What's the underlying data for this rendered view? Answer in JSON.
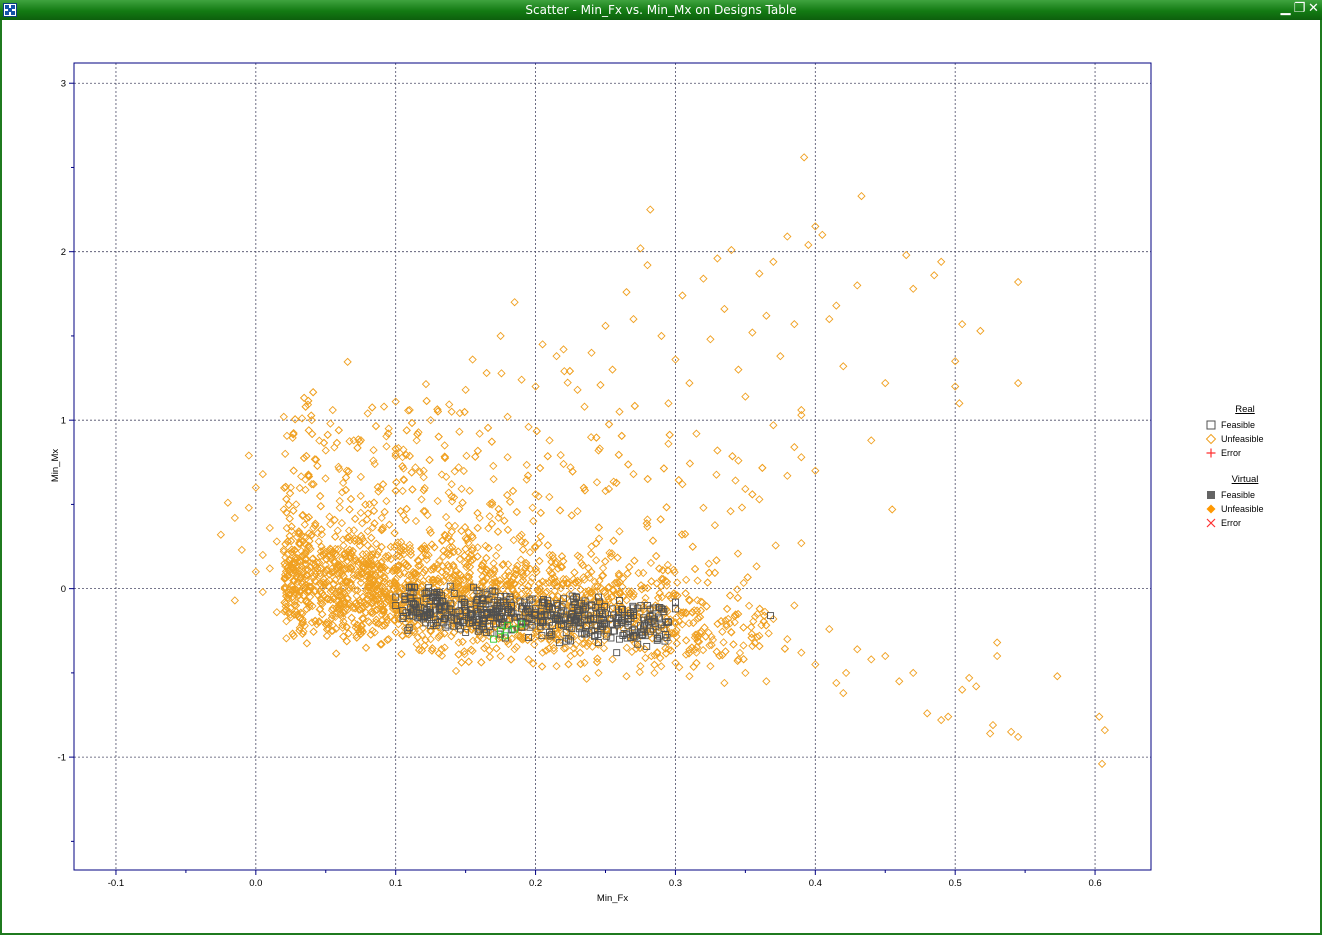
{
  "window": {
    "title": "Scatter - Min_Fx vs. Min_Mx on Designs Table",
    "minimize_glyph": "▁",
    "restore_glyph": "❐",
    "close_glyph": "✕"
  },
  "legend": {
    "groups": [
      {
        "title": "Real",
        "items": [
          {
            "label": "Feasible",
            "marker": "open-square",
            "color": "#505050"
          },
          {
            "label": "Unfeasible",
            "marker": "open-diamond",
            "color": "#f0a020"
          },
          {
            "label": "Error",
            "marker": "plus",
            "color": "#ff3030"
          }
        ]
      },
      {
        "title": "Virtual",
        "items": [
          {
            "label": "Feasible",
            "marker": "filled-square",
            "color": "#646464"
          },
          {
            "label": "Unfeasible",
            "marker": "filled-diamond",
            "color": "#ff9800"
          },
          {
            "label": "Error",
            "marker": "cross",
            "color": "#ff3030"
          }
        ]
      }
    ]
  },
  "chart_data": {
    "type": "scatter",
    "title": "",
    "xlabel": "Min_Fx",
    "ylabel": "Min_Mx",
    "xlim": [
      -0.13,
      0.64
    ],
    "ylim": [
      -1.67,
      3.12
    ],
    "xticks": [
      -0.1,
      0.0,
      0.1,
      0.2,
      0.3,
      0.4,
      0.5,
      0.6
    ],
    "xtick_labels": [
      "-0.1",
      "0.0",
      "0.1",
      "0.2",
      "0.3",
      "0.4",
      "0.5",
      "0.6"
    ],
    "yticks": [
      -1,
      0,
      1,
      2,
      3
    ],
    "ytick_labels": [
      "-1",
      "0",
      "1",
      "2",
      "3"
    ],
    "grid": true,
    "legend_position": "right",
    "colors": {
      "unfeasible": "#f0a020",
      "feasible": "#505050",
      "selected": "#2ecc2e",
      "axis": "#000080"
    },
    "series": [
      {
        "name": "Unfeasible",
        "marker": "open-diamond",
        "points": [
          [
            -0.02,
            0.51
          ],
          [
            -0.025,
            0.32
          ],
          [
            -0.015,
            0.42
          ],
          [
            -0.01,
            0.23
          ],
          [
            -0.015,
            -0.07
          ],
          [
            -0.005,
            0.79
          ],
          [
            -0.005,
            0.48
          ],
          [
            0.0,
            0.1
          ],
          [
            0.0,
            0.6
          ],
          [
            0.005,
            0.68
          ],
          [
            0.005,
            0.2
          ],
          [
            0.01,
            0.36
          ],
          [
            0.015,
            0.28
          ],
          [
            0.02,
            1.02
          ],
          [
            0.02,
            0.47
          ],
          [
            0.025,
            0.6
          ],
          [
            0.03,
            0.18
          ],
          [
            0.035,
            0.38
          ],
          [
            0.04,
            1.0
          ],
          [
            0.04,
            0.62
          ],
          [
            0.045,
            0.28
          ],
          [
            0.05,
            0.82
          ],
          [
            0.055,
            1.06
          ],
          [
            0.06,
            0.48
          ],
          [
            0.065,
            0.7
          ],
          [
            0.07,
            0.88
          ],
          [
            0.075,
            0.55
          ],
          [
            0.08,
            1.04
          ],
          [
            0.085,
            0.74
          ],
          [
            0.09,
            0.42
          ],
          [
            0.095,
            0.95
          ],
          [
            0.1,
            1.11
          ],
          [
            0.1,
            0.8
          ],
          [
            0.105,
            0.58
          ],
          [
            0.11,
            1.06
          ],
          [
            0.115,
            0.88
          ],
          [
            0.12,
            0.7
          ],
          [
            0.125,
            1.0
          ],
          [
            0.13,
            0.52
          ],
          [
            0.135,
            0.85
          ],
          [
            0.14,
            1.05
          ],
          [
            0.145,
            0.72
          ],
          [
            0.15,
            1.18
          ],
          [
            0.155,
            1.36
          ],
          [
            0.16,
            0.92
          ],
          [
            0.165,
            1.28
          ],
          [
            0.17,
            0.65
          ],
          [
            0.175,
            1.5
          ],
          [
            0.18,
            1.02
          ],
          [
            0.185,
            1.7
          ],
          [
            0.19,
            1.24
          ],
          [
            0.195,
            0.96
          ],
          [
            0.2,
            1.2
          ],
          [
            0.205,
            1.45
          ],
          [
            0.21,
            0.88
          ],
          [
            0.215,
            1.38
          ],
          [
            0.22,
            1.42
          ],
          [
            0.225,
            0.72
          ],
          [
            0.23,
            1.18
          ],
          [
            0.235,
            1.08
          ],
          [
            0.24,
            1.4
          ],
          [
            0.245,
            0.82
          ],
          [
            0.25,
            1.56
          ],
          [
            0.255,
            1.3
          ],
          [
            0.26,
            1.05
          ],
          [
            0.265,
            1.76
          ],
          [
            0.27,
            1.6
          ],
          [
            0.275,
            2.02
          ],
          [
            0.28,
            1.92
          ],
          [
            0.282,
            2.25
          ],
          [
            0.29,
            1.5
          ],
          [
            0.295,
            1.1
          ],
          [
            0.3,
            1.36
          ],
          [
            0.305,
            1.74
          ],
          [
            0.31,
            1.22
          ],
          [
            0.315,
            0.92
          ],
          [
            0.32,
            1.84
          ],
          [
            0.325,
            1.48
          ],
          [
            0.33,
            1.96
          ],
          [
            0.335,
            1.66
          ],
          [
            0.34,
            2.01
          ],
          [
            0.345,
            1.3
          ],
          [
            0.35,
            1.14
          ],
          [
            0.355,
            1.52
          ],
          [
            0.36,
            1.87
          ],
          [
            0.365,
            1.62
          ],
          [
            0.37,
            1.94
          ],
          [
            0.375,
            1.38
          ],
          [
            0.38,
            2.09
          ],
          [
            0.385,
            1.57
          ],
          [
            0.39,
            1.06
          ],
          [
            0.392,
            2.56
          ],
          [
            0.395,
            2.04
          ],
          [
            0.4,
            2.15
          ],
          [
            0.405,
            2.1
          ],
          [
            0.41,
            1.6
          ],
          [
            0.415,
            1.68
          ],
          [
            0.42,
            1.32
          ],
          [
            0.43,
            1.8
          ],
          [
            0.433,
            2.33
          ],
          [
            0.44,
            0.88
          ],
          [
            0.45,
            1.22
          ],
          [
            0.455,
            0.47
          ],
          [
            0.465,
            1.98
          ],
          [
            0.47,
            1.78
          ],
          [
            0.485,
            1.86
          ],
          [
            0.49,
            1.94
          ],
          [
            0.5,
            1.35
          ],
          [
            0.5,
            1.2
          ],
          [
            0.503,
            1.1
          ],
          [
            0.505,
            1.57
          ],
          [
            0.518,
            1.53
          ],
          [
            0.545,
            1.82
          ],
          [
            0.545,
            1.22
          ],
          [
            0.38,
            0.67
          ],
          [
            0.385,
            0.84
          ],
          [
            0.39,
            1.03
          ],
          [
            0.39,
            0.27
          ],
          [
            0.4,
            0.7
          ],
          [
            0.39,
            0.78
          ],
          [
            0.37,
            0.97
          ],
          [
            0.36,
            0.53
          ],
          [
            0.345,
            0.76
          ],
          [
            0.33,
            0.82
          ],
          [
            0.32,
            0.48
          ],
          [
            0.305,
            0.62
          ],
          [
            0.295,
            0.86
          ],
          [
            0.28,
            0.41
          ],
          [
            0.27,
            0.68
          ],
          [
            0.26,
            0.34
          ],
          [
            0.25,
            0.58
          ],
          [
            0.24,
            0.25
          ],
          [
            0.23,
            0.46
          ],
          [
            0.22,
            0.74
          ],
          [
            0.21,
            0.2
          ],
          [
            0.2,
            0.56
          ],
          [
            0.19,
            0.32
          ],
          [
            0.18,
            0.78
          ],
          [
            0.17,
            0.15
          ],
          [
            0.16,
            0.42
          ],
          [
            0.15,
            0.3
          ],
          [
            0.14,
            0.62
          ],
          [
            0.13,
            0.12
          ],
          [
            0.12,
            0.46
          ],
          [
            0.11,
            0.26
          ],
          [
            0.1,
            0.58
          ],
          [
            0.09,
            0.16
          ],
          [
            0.08,
            0.34
          ],
          [
            0.07,
            0.08
          ],
          [
            0.06,
            0.52
          ],
          [
            0.05,
            0.14
          ],
          [
            0.04,
            0.32
          ],
          [
            0.03,
            0.04
          ],
          [
            0.02,
            0.22
          ],
          [
            0.01,
            0.12
          ],
          [
            0.005,
            -0.02
          ],
          [
            0.37,
            -0.18
          ],
          [
            0.38,
            -0.3
          ],
          [
            0.385,
            -0.1
          ],
          [
            0.39,
            -0.38
          ],
          [
            0.4,
            -0.45
          ],
          [
            0.41,
            -0.24
          ],
          [
            0.415,
            -0.56
          ],
          [
            0.42,
            -0.62
          ],
          [
            0.422,
            -0.5
          ],
          [
            0.43,
            -0.36
          ],
          [
            0.44,
            -0.42
          ],
          [
            0.45,
            -0.4
          ],
          [
            0.46,
            -0.55
          ],
          [
            0.47,
            -0.5
          ],
          [
            0.48,
            -0.74
          ],
          [
            0.49,
            -0.78
          ],
          [
            0.495,
            -0.76
          ],
          [
            0.505,
            -0.6
          ],
          [
            0.51,
            -0.53
          ],
          [
            0.515,
            -0.58
          ],
          [
            0.525,
            -0.86
          ],
          [
            0.527,
            -0.81
          ],
          [
            0.53,
            -0.32
          ],
          [
            0.53,
            -0.4
          ],
          [
            0.54,
            -0.85
          ],
          [
            0.545,
            -0.88
          ],
          [
            0.573,
            -0.52
          ],
          [
            0.603,
            -0.76
          ],
          [
            0.605,
            -1.04
          ],
          [
            0.607,
            -0.84
          ],
          [
            0.35,
            -0.5
          ],
          [
            0.36,
            -0.28
          ],
          [
            0.365,
            -0.55
          ],
          [
            0.345,
            -0.42
          ],
          [
            0.355,
            -0.34
          ],
          [
            0.335,
            -0.56
          ],
          [
            0.325,
            -0.46
          ],
          [
            0.315,
            -0.38
          ],
          [
            0.34,
            -0.26
          ],
          [
            0.31,
            -0.52
          ],
          [
            0.3,
            -0.44
          ],
          [
            0.295,
            -0.36
          ],
          [
            0.285,
            -0.5
          ],
          [
            0.275,
            -0.46
          ],
          [
            0.265,
            -0.52
          ],
          [
            0.255,
            -0.42
          ],
          [
            0.245,
            -0.5
          ],
          [
            0.235,
            -0.44
          ],
          [
            0.225,
            -0.4
          ],
          [
            0.215,
            -0.46
          ],
          [
            0.205,
            -0.38
          ],
          [
            0.195,
            -0.42
          ],
          [
            0.185,
            -0.36
          ],
          [
            0.175,
            -0.4
          ],
          [
            0.165,
            -0.34
          ],
          [
            0.155,
            -0.37
          ],
          [
            0.145,
            -0.32
          ],
          [
            0.135,
            -0.35
          ],
          [
            0.125,
            -0.3
          ],
          [
            0.115,
            -0.33
          ],
          [
            0.105,
            -0.28
          ],
          [
            0.095,
            -0.3
          ],
          [
            0.085,
            -0.26
          ],
          [
            0.075,
            -0.27
          ],
          [
            0.065,
            -0.23
          ],
          [
            0.055,
            -0.25
          ],
          [
            0.045,
            -0.2
          ],
          [
            0.035,
            -0.22
          ],
          [
            0.025,
            -0.17
          ],
          [
            0.015,
            -0.14
          ]
        ]
      },
      {
        "name": "Feasible",
        "marker": "open-square",
        "points": [
          [
            0.1,
            -0.05
          ],
          [
            0.1,
            -0.1
          ],
          [
            0.105,
            -0.13
          ],
          [
            0.11,
            -0.16
          ],
          [
            0.115,
            -0.12
          ],
          [
            0.12,
            -0.18
          ],
          [
            0.125,
            -0.14
          ],
          [
            0.13,
            -0.2
          ],
          [
            0.135,
            -0.11
          ],
          [
            0.14,
            -0.17
          ],
          [
            0.145,
            -0.22
          ],
          [
            0.15,
            -0.13
          ],
          [
            0.155,
            -0.19
          ],
          [
            0.16,
            -0.24
          ],
          [
            0.165,
            -0.15
          ],
          [
            0.17,
            -0.21
          ],
          [
            0.175,
            -0.27
          ],
          [
            0.18,
            -0.11
          ],
          [
            0.185,
            -0.17
          ],
          [
            0.19,
            -0.23
          ],
          [
            0.195,
            -0.29
          ],
          [
            0.2,
            -0.14
          ],
          [
            0.205,
            -0.2
          ],
          [
            0.21,
            -0.26
          ],
          [
            0.215,
            -0.16
          ],
          [
            0.22,
            -0.22
          ],
          [
            0.225,
            -0.31
          ],
          [
            0.23,
            -0.12
          ],
          [
            0.235,
            -0.18
          ],
          [
            0.24,
            -0.25
          ],
          [
            0.245,
            -0.32
          ],
          [
            0.25,
            -0.15
          ],
          [
            0.255,
            -0.21
          ],
          [
            0.258,
            -0.38
          ],
          [
            0.26,
            -0.07
          ],
          [
            0.265,
            -0.27
          ],
          [
            0.27,
            -0.16
          ],
          [
            0.275,
            -0.22
          ],
          [
            0.28,
            -0.1
          ],
          [
            0.285,
            -0.18
          ],
          [
            0.29,
            -0.12
          ],
          [
            0.295,
            -0.2
          ],
          [
            0.3,
            -0.12
          ],
          [
            0.3,
            -0.08
          ],
          [
            0.368,
            -0.16
          ],
          [
            0.165,
            -0.26
          ],
          [
            0.175,
            -0.09
          ],
          [
            0.205,
            -0.08
          ],
          [
            0.22,
            -0.06
          ],
          [
            0.245,
            -0.05
          ],
          [
            0.15,
            -0.26
          ],
          [
            0.125,
            -0.22
          ],
          [
            0.17,
            -0.14
          ],
          [
            0.235,
            -0.27
          ],
          [
            0.26,
            -0.3
          ],
          [
            0.27,
            -0.28
          ],
          [
            0.21,
            -0.11
          ],
          [
            0.19,
            -0.12
          ],
          [
            0.14,
            -0.14
          ],
          [
            0.255,
            -0.12
          ]
        ]
      },
      {
        "name": "Selected",
        "marker": "open-square",
        "points": [
          [
            0.17,
            -0.3
          ],
          [
            0.175,
            -0.25
          ],
          [
            0.18,
            -0.22
          ],
          [
            0.185,
            -0.24
          ],
          [
            0.19,
            -0.21
          ],
          [
            0.178,
            -0.28
          ]
        ]
      }
    ]
  }
}
